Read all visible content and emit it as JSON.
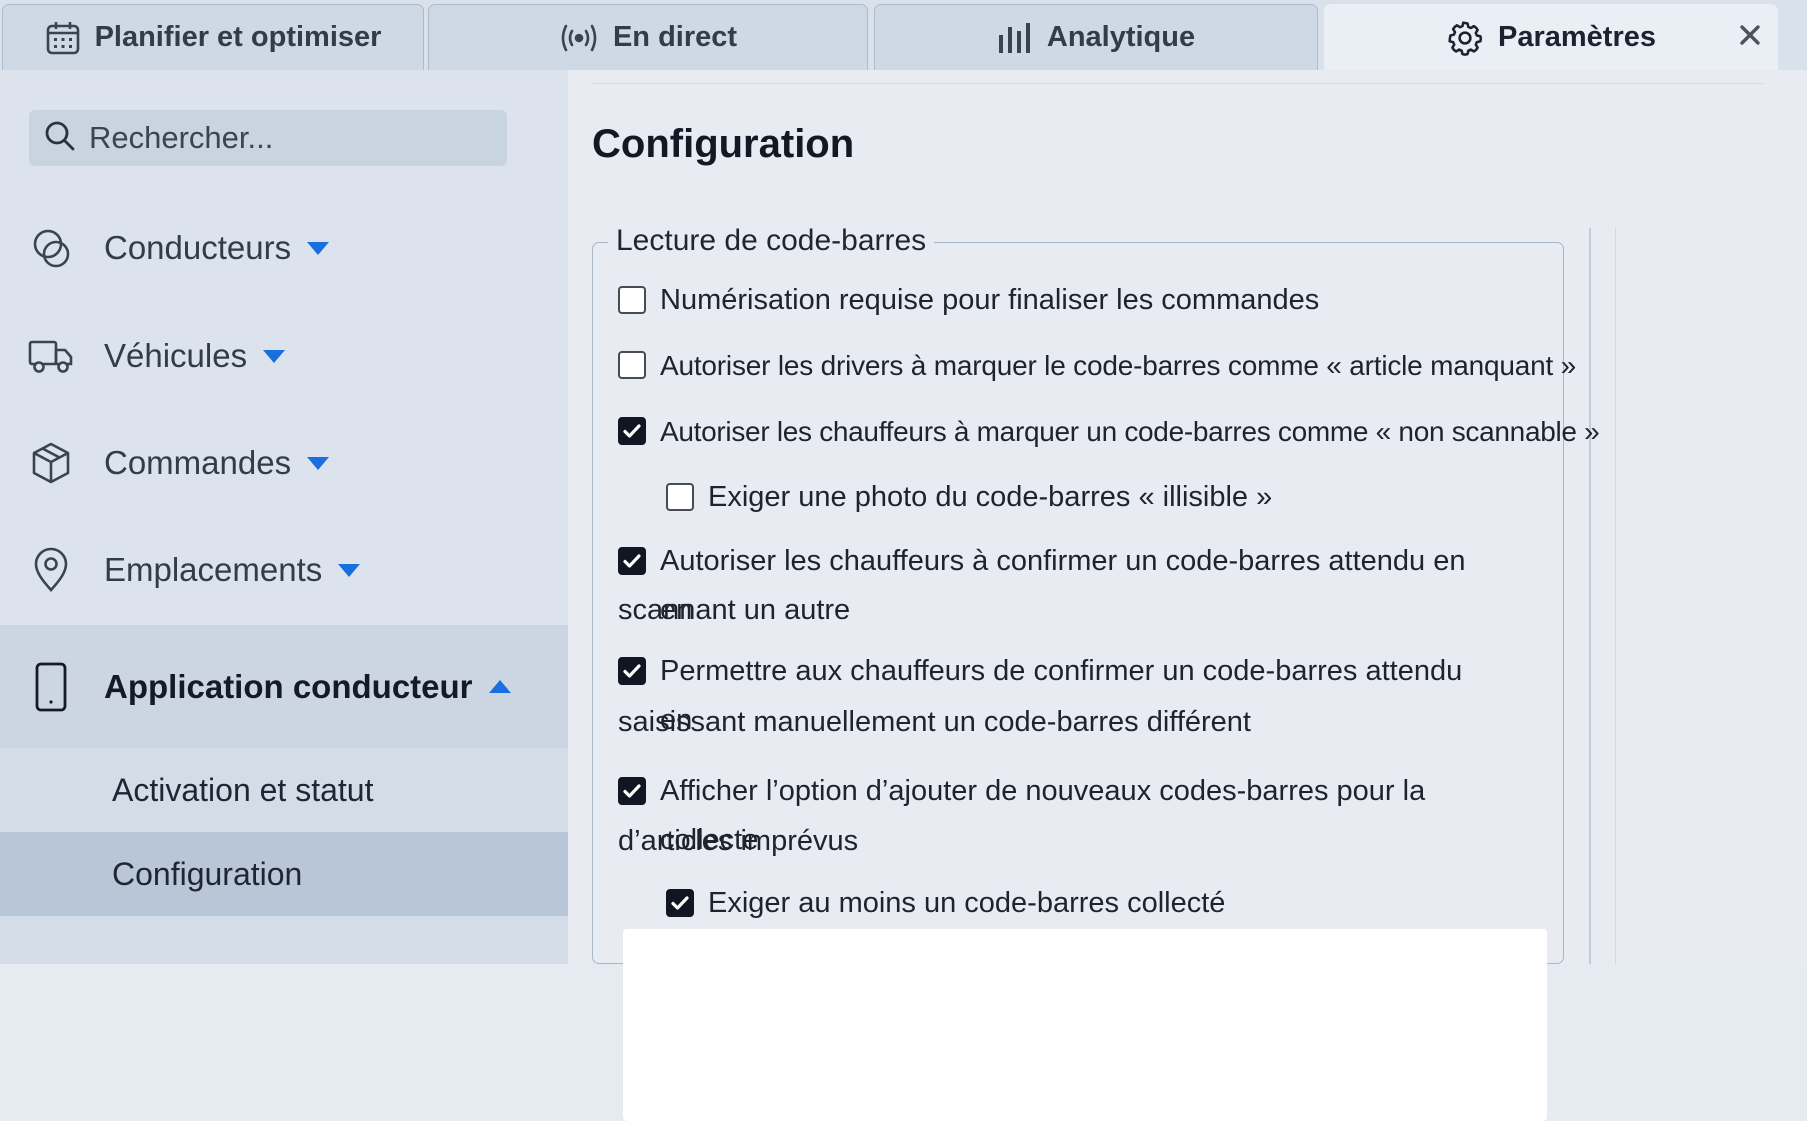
{
  "tabs": [
    {
      "label": "Planifier et optimiser",
      "icon": "calendar-icon"
    },
    {
      "label": "En direct",
      "icon": "broadcast-icon"
    },
    {
      "label": "Analytique",
      "icon": "bar-chart-icon"
    },
    {
      "label": "Paramètres",
      "icon": "gear-icon",
      "active": true
    }
  ],
  "close_icon": "close-icon",
  "sidebar": {
    "search_placeholder": "Rechercher...",
    "items": [
      {
        "label": "Conducteurs",
        "icon": "drivers-icon",
        "expanded": false
      },
      {
        "label": "Véhicules",
        "icon": "truck-icon",
        "expanded": false
      },
      {
        "label": "Commandes",
        "icon": "package-icon",
        "expanded": false
      },
      {
        "label": "Emplacements",
        "icon": "location-pin-icon",
        "expanded": false
      },
      {
        "label": "Application conducteur",
        "icon": "phone-icon",
        "expanded": true
      }
    ],
    "subitems": [
      {
        "label": "Activation et statut",
        "selected": false
      },
      {
        "label": "Configuration",
        "selected": true
      }
    ]
  },
  "content": {
    "title": "Configuration",
    "section_title": "Lecture de code-barres",
    "options": [
      {
        "label": "Numérisation requise pour finaliser les commandes",
        "checked": false
      },
      {
        "label": "Autoriser les drivers à marquer le code-barres comme « article manquant »",
        "checked": false
      },
      {
        "label": "Autoriser les chauffeurs à marquer un code-barres comme « non scannable »",
        "checked": true
      },
      {
        "label": "Exiger une photo du code-barres « illisible »",
        "checked": false
      },
      {
        "label_line1": "Autoriser les chauffeurs à confirmer un code-barres attendu en en",
        "label_line2": "scannant un autre",
        "checked": true
      },
      {
        "label_line1": "Permettre aux chauffeurs de confirmer un code-barres attendu en",
        "label_line2": "saisissant manuellement un code-barres différent",
        "checked": true
      },
      {
        "label_line1": "Afficher l’option d’ajouter de nouveaux codes-barres pour la collecte",
        "label_line2": "d’articles imprévus",
        "checked": true
      },
      {
        "label": "Exiger au moins un code-barres collecté",
        "checked": true
      }
    ]
  },
  "colors": {
    "accent": "#1a6fe0",
    "checkbox_checked": "#111722",
    "sidebar_selected": "#b8c6d7"
  }
}
